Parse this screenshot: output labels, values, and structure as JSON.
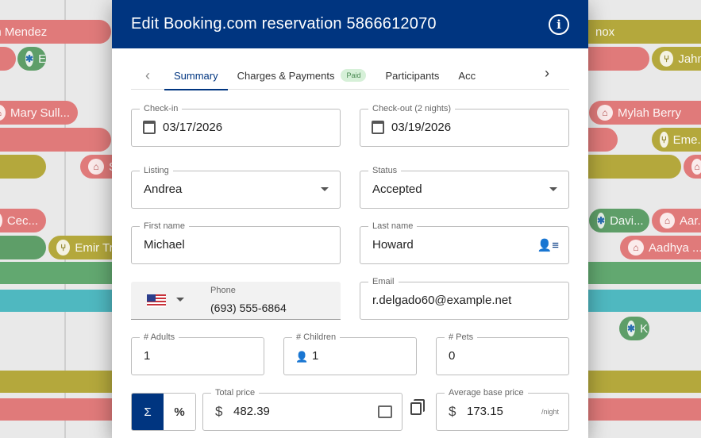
{
  "dialog": {
    "title": "Edit Booking.com reservation 5866612070",
    "info_icon": "info-icon"
  },
  "tabs": {
    "items": [
      {
        "label": "Summary",
        "active": true
      },
      {
        "label": "Charges & Payments",
        "badge": "Paid"
      },
      {
        "label": "Participants"
      },
      {
        "label": "Acc"
      }
    ]
  },
  "form": {
    "checkin": {
      "label": "Check-in",
      "value": "03/17/2026"
    },
    "checkout": {
      "label": "Check-out (2 nights)",
      "value": "03/19/2026"
    },
    "listing": {
      "label": "Listing",
      "value": "Andrea"
    },
    "status": {
      "label": "Status",
      "value": "Accepted"
    },
    "first_name": {
      "label": "First name",
      "value": "Michael"
    },
    "last_name": {
      "label": "Last name",
      "value": "Howard"
    },
    "phone": {
      "label": "Phone",
      "value": "(693) 555-6864",
      "country": "US"
    },
    "email": {
      "label": "Email",
      "value": "r.delgado60@example.net"
    },
    "adults": {
      "label": "# Adults",
      "value": "1"
    },
    "children": {
      "label": "# Children",
      "value": "1"
    },
    "pets": {
      "label": "# Pets",
      "value": "0"
    },
    "toggle": {
      "sum": "Σ",
      "percent": "%"
    },
    "total_price": {
      "label": "Total price",
      "currency": "$",
      "value": "482.39"
    },
    "avg_price": {
      "label": "Average base price",
      "currency": "$",
      "value": "173.15",
      "unit": "/night"
    }
  },
  "background": {
    "bookings": [
      "in Mendez",
      "E",
      "Mary Sull...",
      "S",
      "Cec...",
      "Emir Tra",
      "nox",
      "Jahm",
      "Mylah Berry",
      "Eme...",
      "Davi...",
      "Aar...",
      "Aadhya ...",
      "K"
    ]
  },
  "colors": {
    "brand": "#003580",
    "airbnb": "#e07a7a",
    "booking": "#b4a83c",
    "direct": "#5e9e68"
  }
}
